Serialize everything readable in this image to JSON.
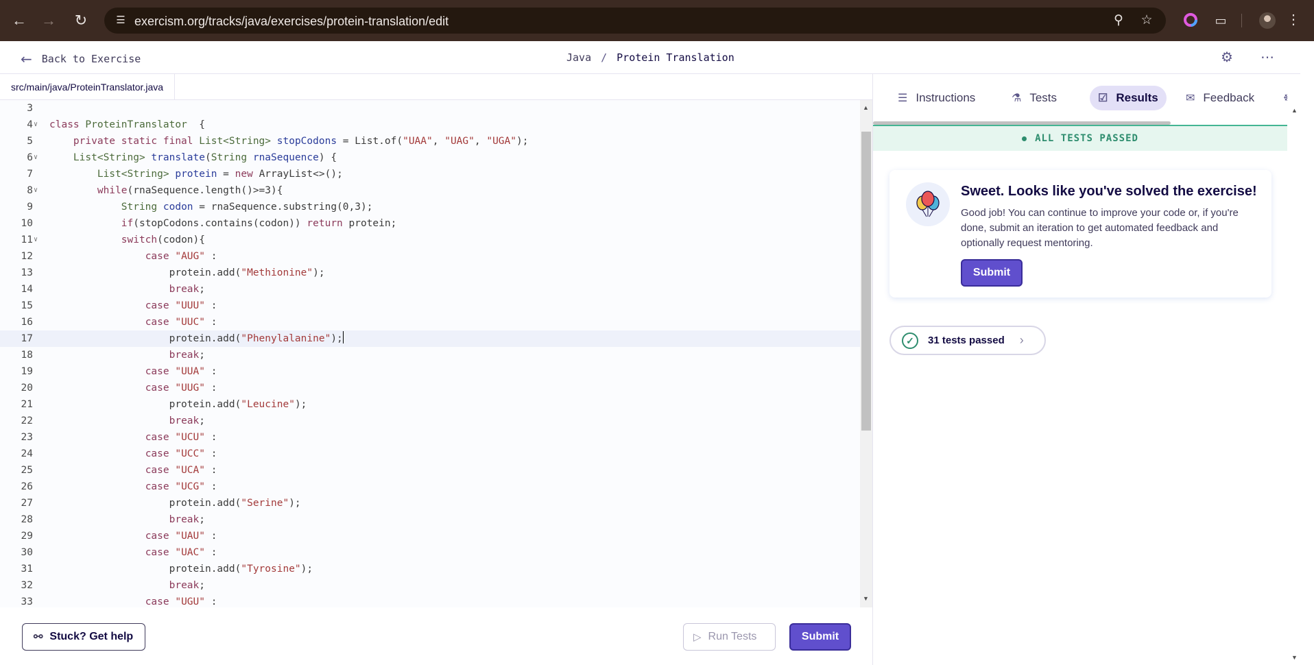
{
  "browser": {
    "url": "exercism.org/tracks/java/exercises/protein-translation/edit",
    "icons": [
      "back-icon",
      "forward-icon",
      "reload-icon",
      "site-settings-icon",
      "zoom-icon",
      "bookmark-star-icon",
      "extension-color-icon",
      "extensions-puzzle-icon",
      "profile-avatar",
      "menu-dots-icon"
    ]
  },
  "header": {
    "back_label": "Back to Exercise",
    "track": "Java",
    "separator": "/",
    "exercise": "Protein Translation"
  },
  "editor": {
    "file_tab": "src/main/java/ProteinTranslator.java",
    "lines": [
      {
        "n": "3",
        "fold": false,
        "segments": []
      },
      {
        "n": "4",
        "fold": true,
        "segments": [
          [
            "kw",
            "class "
          ],
          [
            "ty",
            "ProteinTranslator"
          ],
          [
            "",
            "  {"
          ]
        ]
      },
      {
        "n": "5",
        "fold": false,
        "segments": [
          [
            "",
            "    "
          ],
          [
            "kw",
            "private static final "
          ],
          [
            "ty",
            "List<String> "
          ],
          [
            "var",
            "stopCodons"
          ],
          [
            "",
            " = List.of("
          ],
          [
            "str",
            "\"UAA\""
          ],
          [
            "",
            ", "
          ],
          [
            "str",
            "\"UAG\""
          ],
          [
            "",
            ", "
          ],
          [
            "str",
            "\"UGA\""
          ],
          [
            "",
            ");"
          ]
        ]
      },
      {
        "n": "6",
        "fold": true,
        "segments": [
          [
            "",
            "    "
          ],
          [
            "ty",
            "List<String> "
          ],
          [
            "var",
            "translate"
          ],
          [
            "",
            "("
          ],
          [
            "ty",
            "String "
          ],
          [
            "var",
            "rnaSequence"
          ],
          [
            "",
            ") {"
          ]
        ]
      },
      {
        "n": "7",
        "fold": false,
        "segments": [
          [
            "",
            "        "
          ],
          [
            "ty",
            "List<String> "
          ],
          [
            "var",
            "protein"
          ],
          [
            "",
            " = "
          ],
          [
            "kw",
            "new "
          ],
          [
            "",
            "ArrayList<>();"
          ]
        ]
      },
      {
        "n": "8",
        "fold": true,
        "segments": [
          [
            "",
            "        "
          ],
          [
            "kw",
            "while"
          ],
          [
            "",
            "(rnaSequence.length()>=3){"
          ]
        ]
      },
      {
        "n": "9",
        "fold": false,
        "segments": [
          [
            "",
            "            "
          ],
          [
            "ty",
            "String "
          ],
          [
            "var",
            "codon"
          ],
          [
            "",
            " = rnaSequence.substring(0,3);"
          ]
        ]
      },
      {
        "n": "10",
        "fold": false,
        "segments": [
          [
            "",
            "            "
          ],
          [
            "kw",
            "if"
          ],
          [
            "",
            "(stopCodons.contains(codon)) "
          ],
          [
            "kw",
            "return "
          ],
          [
            "",
            "protein;"
          ]
        ]
      },
      {
        "n": "11",
        "fold": true,
        "segments": [
          [
            "",
            "            "
          ],
          [
            "kw",
            "switch"
          ],
          [
            "",
            "(codon){"
          ]
        ]
      },
      {
        "n": "12",
        "fold": false,
        "segments": [
          [
            "",
            "                "
          ],
          [
            "kw",
            "case "
          ],
          [
            "str",
            "\"AUG\""
          ],
          [
            "",
            " :"
          ]
        ]
      },
      {
        "n": "13",
        "fold": false,
        "segments": [
          [
            "",
            "                    protein.add("
          ],
          [
            "str",
            "\"Methionine\""
          ],
          [
            "",
            ");"
          ]
        ]
      },
      {
        "n": "14",
        "fold": false,
        "segments": [
          [
            "",
            "                    "
          ],
          [
            "kw",
            "break"
          ],
          [
            "",
            ";"
          ]
        ]
      },
      {
        "n": "15",
        "fold": false,
        "segments": [
          [
            "",
            "                "
          ],
          [
            "kw",
            "case "
          ],
          [
            "str",
            "\"UUU\""
          ],
          [
            "",
            " :"
          ]
        ]
      },
      {
        "n": "16",
        "fold": false,
        "segments": [
          [
            "",
            "                "
          ],
          [
            "kw",
            "case "
          ],
          [
            "str",
            "\"UUC\""
          ],
          [
            "",
            " :"
          ]
        ]
      },
      {
        "n": "17",
        "fold": false,
        "active": true,
        "segments": [
          [
            "",
            "                    protein.add("
          ],
          [
            "str",
            "\"Phenylalanine\""
          ],
          [
            "",
            ");"
          ]
        ]
      },
      {
        "n": "18",
        "fold": false,
        "segments": [
          [
            "",
            "                    "
          ],
          [
            "kw",
            "break"
          ],
          [
            "",
            ";"
          ]
        ]
      },
      {
        "n": "19",
        "fold": false,
        "segments": [
          [
            "",
            "                "
          ],
          [
            "kw",
            "case "
          ],
          [
            "str",
            "\"UUA\""
          ],
          [
            "",
            " :"
          ]
        ]
      },
      {
        "n": "20",
        "fold": false,
        "segments": [
          [
            "",
            "                "
          ],
          [
            "kw",
            "case "
          ],
          [
            "str",
            "\"UUG\""
          ],
          [
            "",
            " :"
          ]
        ]
      },
      {
        "n": "21",
        "fold": false,
        "segments": [
          [
            "",
            "                    protein.add("
          ],
          [
            "str",
            "\"Leucine\""
          ],
          [
            "",
            ");"
          ]
        ]
      },
      {
        "n": "22",
        "fold": false,
        "segments": [
          [
            "",
            "                    "
          ],
          [
            "kw",
            "break"
          ],
          [
            "",
            ";"
          ]
        ]
      },
      {
        "n": "23",
        "fold": false,
        "segments": [
          [
            "",
            "                "
          ],
          [
            "kw",
            "case "
          ],
          [
            "str",
            "\"UCU\""
          ],
          [
            "",
            " :"
          ]
        ]
      },
      {
        "n": "24",
        "fold": false,
        "segments": [
          [
            "",
            "                "
          ],
          [
            "kw",
            "case "
          ],
          [
            "str",
            "\"UCC\""
          ],
          [
            "",
            " :"
          ]
        ]
      },
      {
        "n": "25",
        "fold": false,
        "segments": [
          [
            "",
            "                "
          ],
          [
            "kw",
            "case "
          ],
          [
            "str",
            "\"UCA\""
          ],
          [
            "",
            " :"
          ]
        ]
      },
      {
        "n": "26",
        "fold": false,
        "segments": [
          [
            "",
            "                "
          ],
          [
            "kw",
            "case "
          ],
          [
            "str",
            "\"UCG\""
          ],
          [
            "",
            " :"
          ]
        ]
      },
      {
        "n": "27",
        "fold": false,
        "segments": [
          [
            "",
            "                    protein.add("
          ],
          [
            "str",
            "\"Serine\""
          ],
          [
            "",
            ");"
          ]
        ]
      },
      {
        "n": "28",
        "fold": false,
        "segments": [
          [
            "",
            "                    "
          ],
          [
            "kw",
            "break"
          ],
          [
            "",
            ";"
          ]
        ]
      },
      {
        "n": "29",
        "fold": false,
        "segments": [
          [
            "",
            "                "
          ],
          [
            "kw",
            "case "
          ],
          [
            "str",
            "\"UAU\""
          ],
          [
            "",
            " :"
          ]
        ]
      },
      {
        "n": "30",
        "fold": false,
        "segments": [
          [
            "",
            "                "
          ],
          [
            "kw",
            "case "
          ],
          [
            "str",
            "\"UAC\""
          ],
          [
            "",
            " :"
          ]
        ]
      },
      {
        "n": "31",
        "fold": false,
        "segments": [
          [
            "",
            "                    protein.add("
          ],
          [
            "str",
            "\"Tyrosine\""
          ],
          [
            "",
            ");"
          ]
        ]
      },
      {
        "n": "32",
        "fold": false,
        "segments": [
          [
            "",
            "                    "
          ],
          [
            "kw",
            "break"
          ],
          [
            "",
            ";"
          ]
        ]
      },
      {
        "n": "33",
        "fold": false,
        "segments": [
          [
            "",
            "                "
          ],
          [
            "kw",
            "case "
          ],
          [
            "str",
            "\"UGU\""
          ],
          [
            "",
            " :"
          ]
        ]
      }
    ],
    "help_label": "Stuck? Get help",
    "run_label": "Run Tests",
    "submit_label": "Submit"
  },
  "panel": {
    "tabs": [
      {
        "label": "Instructions",
        "icon": "instructions-icon",
        "active": false
      },
      {
        "label": "Tests",
        "icon": "tests-icon",
        "active": false
      },
      {
        "label": "Results",
        "icon": "results-icon",
        "active": true
      },
      {
        "label": "Feedback",
        "icon": "feedback-icon",
        "active": false
      }
    ],
    "banner": "ALL TESTS PASSED",
    "card": {
      "title": "Sweet. Looks like you've solved the exercise!",
      "body": "Good job! You can continue to improve your code or, if you're done, submit an iteration to get automated feedback and optionally request mentoring.",
      "submit_label": "Submit"
    },
    "tests_passed": "31 tests passed"
  },
  "colors": {
    "accent": "#604fcd",
    "success": "#2e8d6e",
    "success_bg": "#e6f6ef",
    "chrome": "#3c2a22"
  }
}
